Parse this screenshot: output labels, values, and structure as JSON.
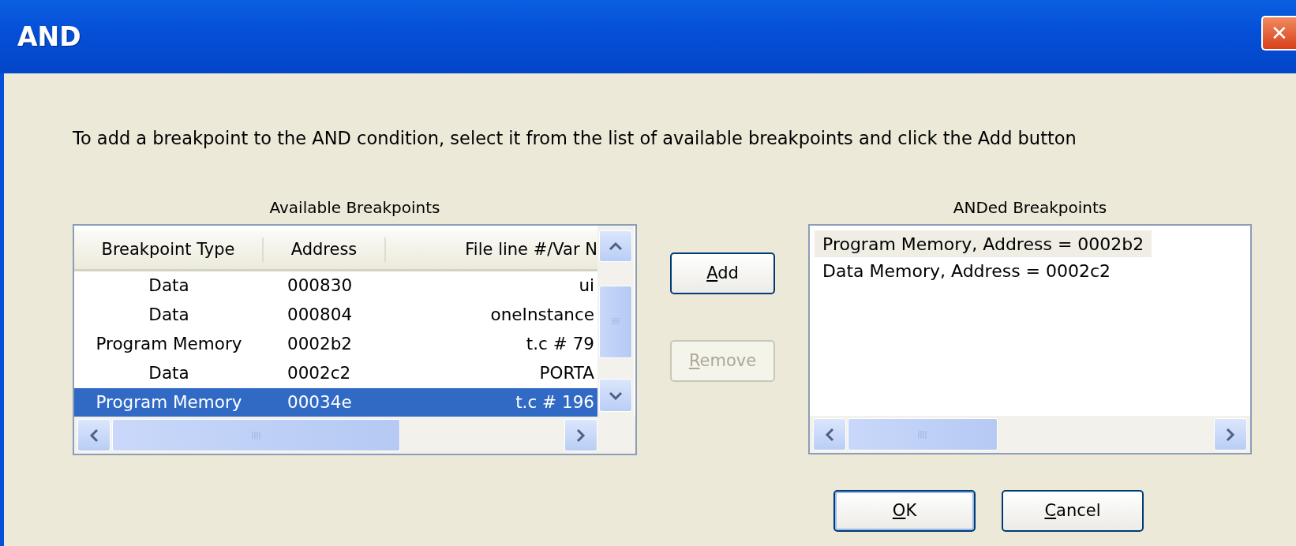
{
  "window": {
    "title": "AND",
    "close": "✕"
  },
  "instruction": "To add a breakpoint to the AND condition, select it from the list of available breakpoints and click the Add button",
  "available": {
    "label": "Available Breakpoints",
    "columns": [
      "Breakpoint Type",
      "Address",
      "File line #/Var N"
    ],
    "rows": [
      {
        "type": "Data",
        "address": "000830",
        "location": "ui",
        "selected": false
      },
      {
        "type": "Data",
        "address": "000804",
        "location": "oneInstance",
        "selected": false
      },
      {
        "type": "Program Memory",
        "address": "0002b2",
        "location": "t.c # 79",
        "selected": false
      },
      {
        "type": "Data",
        "address": "0002c2",
        "location": "PORTA",
        "selected": false
      },
      {
        "type": "Program Memory",
        "address": "00034e",
        "location": "t.c # 196",
        "selected": true
      }
    ]
  },
  "middle_buttons": [
    {
      "label": "Add",
      "disabled": false
    },
    {
      "label": "Remove",
      "disabled": true
    }
  ],
  "anded": {
    "label": "ANDed Breakpoints",
    "items": [
      {
        "text": "Program Memory, Address = 0002b2",
        "selected": true
      },
      {
        "text": "Data Memory, Address = 0002c2",
        "selected": false
      }
    ]
  },
  "buttons": [
    {
      "label": "OK",
      "default": true
    },
    {
      "label": "Cancel",
      "default": false
    }
  ]
}
